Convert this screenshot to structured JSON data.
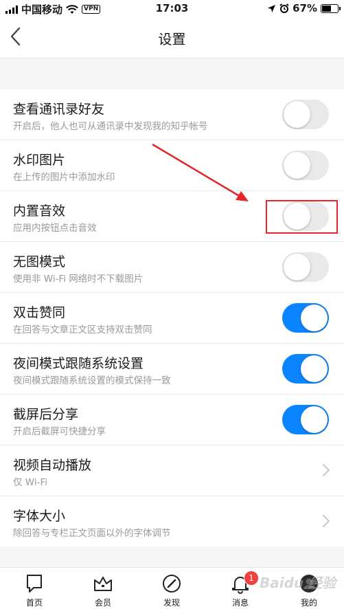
{
  "status_bar": {
    "carrier": "中国移动",
    "vpn": "VPN",
    "time": "17:03",
    "battery": "67%",
    "battery_level": 0.67
  },
  "nav": {
    "title": "设置"
  },
  "settings": [
    {
      "title": "查看通讯录好友",
      "desc": "开启后，他人也可从通讯录中发现我的知乎帐号",
      "control": "toggle",
      "on": false
    },
    {
      "title": "水印图片",
      "desc": "在上传的图片中添加水印",
      "control": "toggle",
      "on": false
    },
    {
      "title": "内置音效",
      "desc": "应用内按钮点击音效",
      "control": "toggle",
      "on": false
    },
    {
      "title": "无图模式",
      "desc": "使用非 Wi-Fi 网络时不下载图片",
      "control": "toggle",
      "on": false
    },
    {
      "title": "双击赞同",
      "desc": "在回答与文章正文区支持双击赞同",
      "control": "toggle",
      "on": true
    },
    {
      "title": "夜间模式跟随系统设置",
      "desc": "夜间模式跟随系统设置的模式保持一致",
      "control": "toggle",
      "on": true
    },
    {
      "title": "截屏后分享",
      "desc": "开启后截屏可快捷分享",
      "control": "toggle",
      "on": true
    },
    {
      "title": "视频自动播放",
      "desc": "仅 Wi-Fi",
      "control": "chevron"
    },
    {
      "title": "字体大小",
      "desc": "除回答与专栏正文页面以外的字体调节",
      "control": "chevron"
    }
  ],
  "tabs": [
    {
      "label": "首页",
      "icon": "home-icon"
    },
    {
      "label": "会员",
      "icon": "crown-icon"
    },
    {
      "label": "发现",
      "icon": "compass-icon"
    },
    {
      "label": "消息",
      "icon": "bell-icon",
      "badge": "1"
    },
    {
      "label": "我的",
      "icon": "avatar-icon"
    }
  ],
  "watermark": "Baidu 经验",
  "colors": {
    "toggle_on": "#0b84ff",
    "toggle_off": "#e9e9ea",
    "annotation": "#e2262b",
    "badge": "#f1403c"
  }
}
